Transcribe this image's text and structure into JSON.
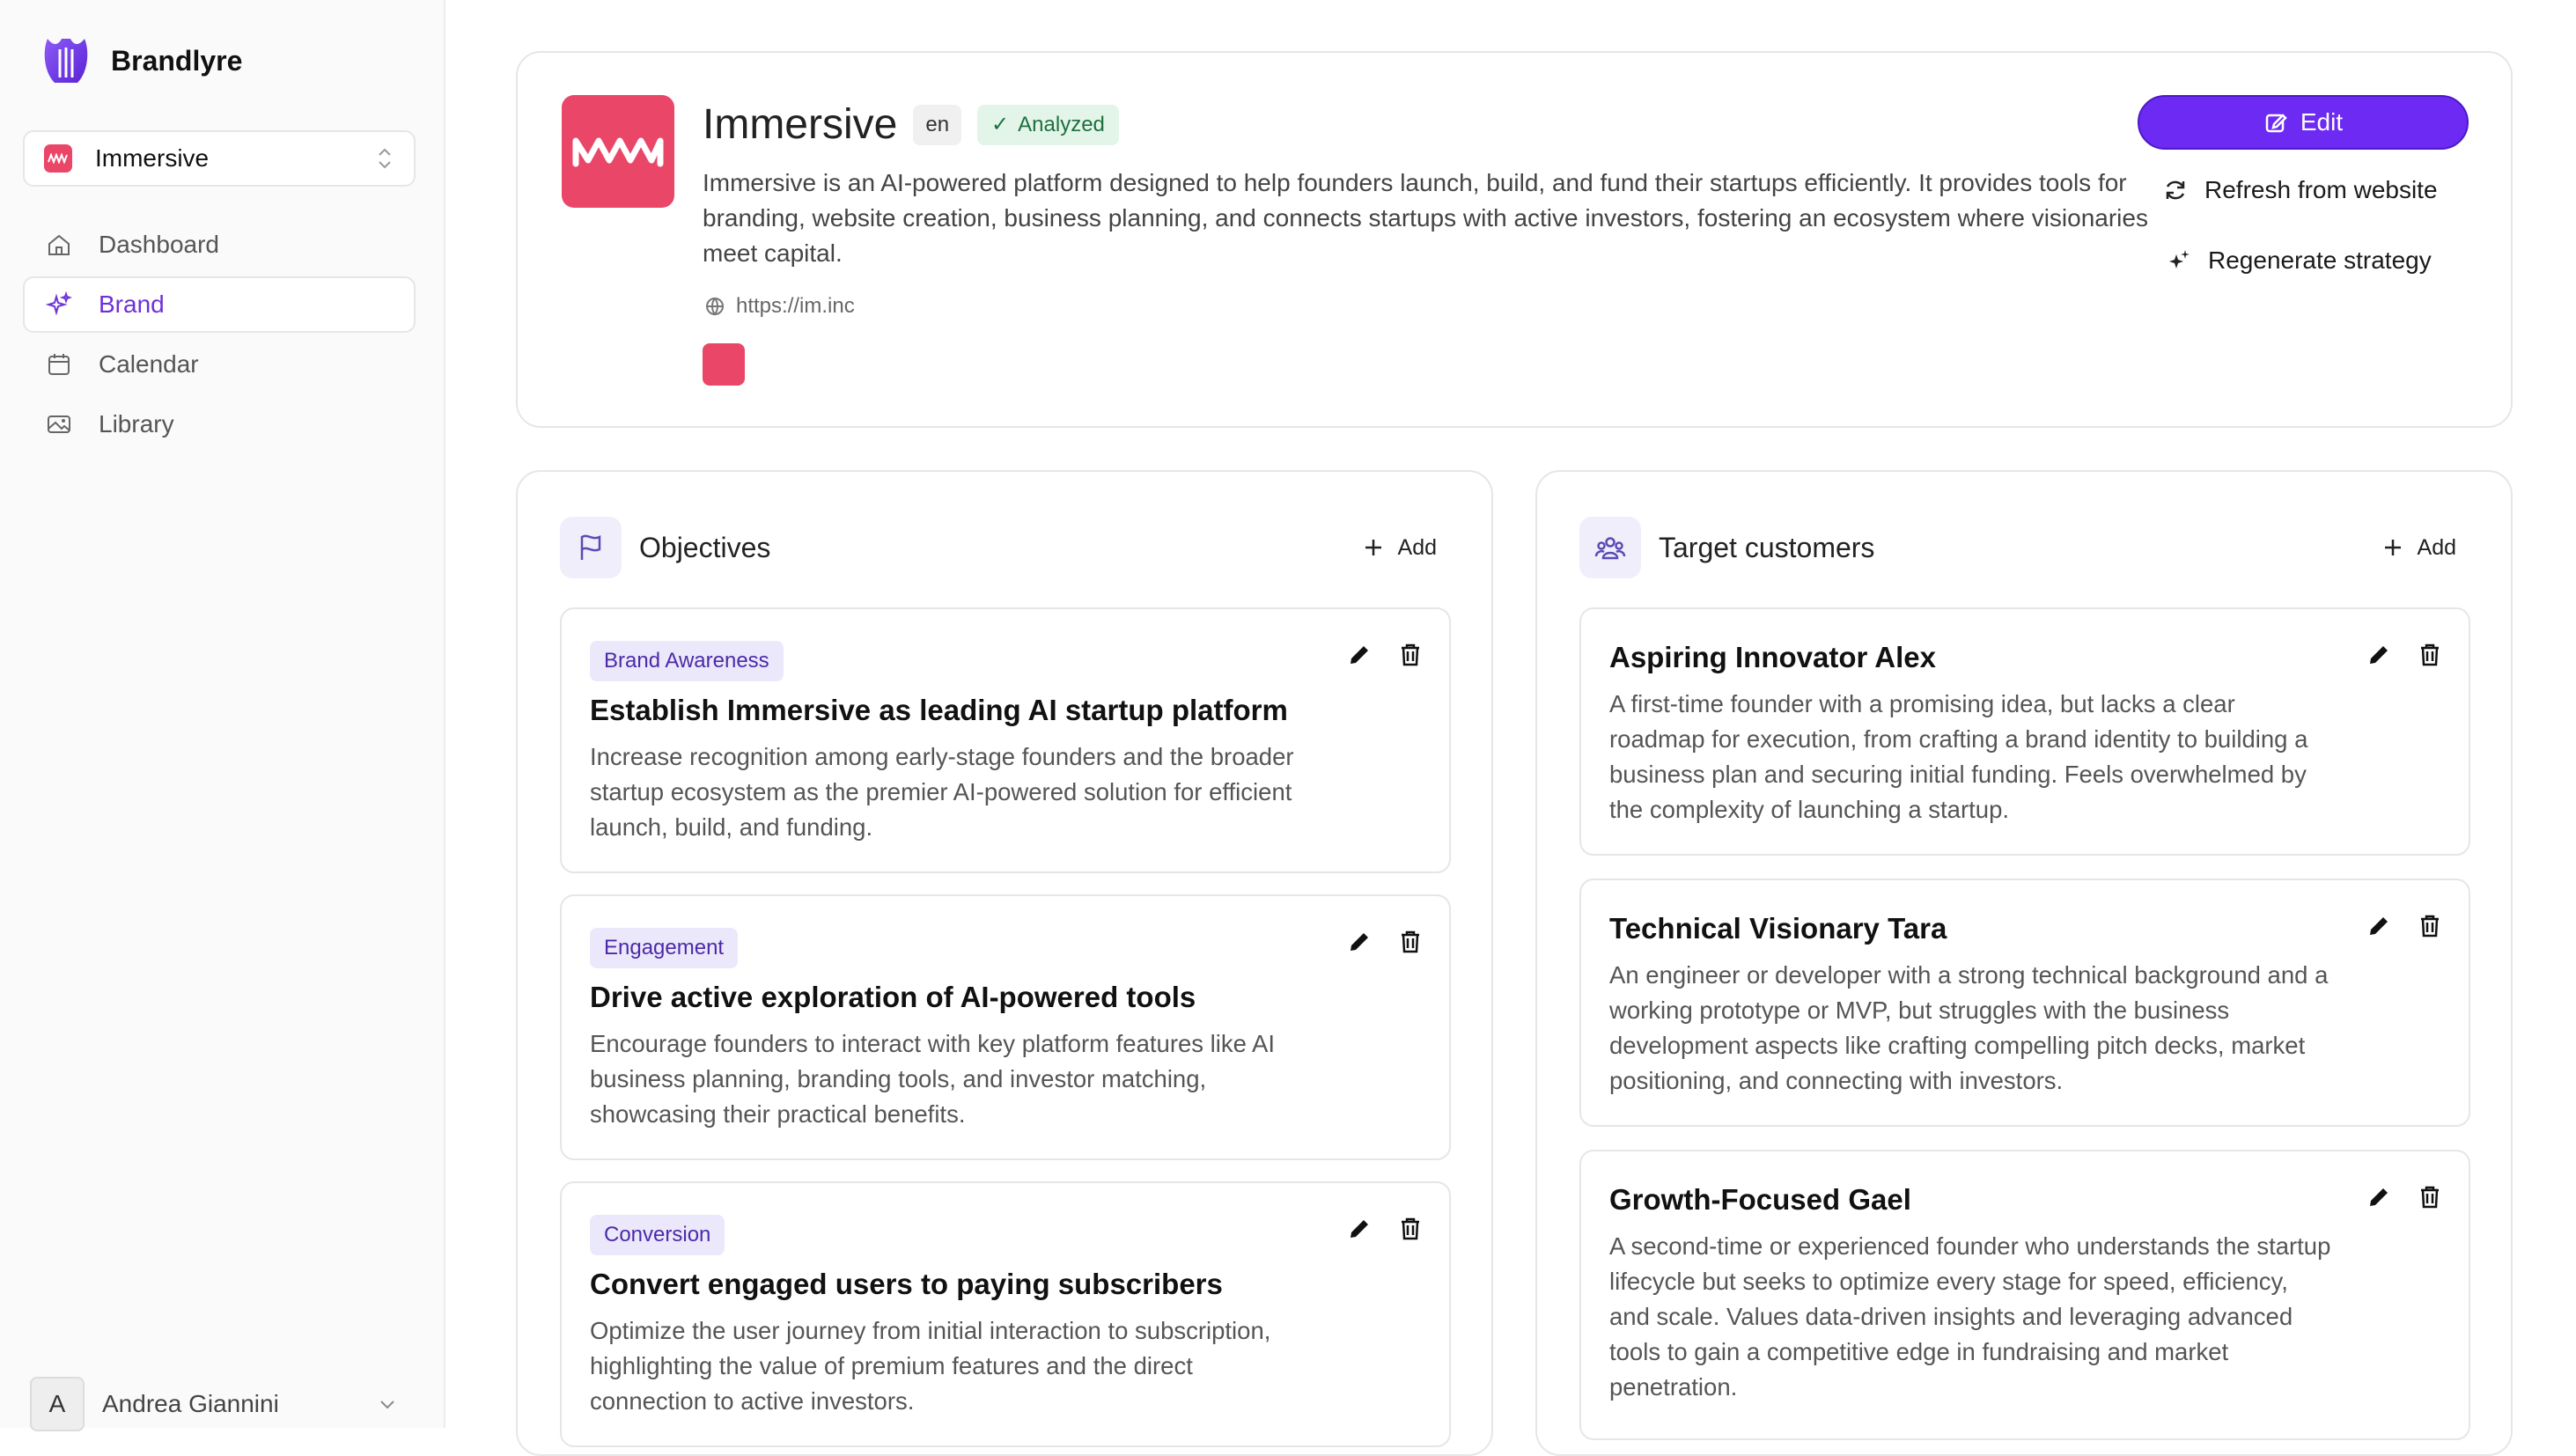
{
  "app": {
    "name": "Brandlyre"
  },
  "workspace": {
    "name": "Immersive"
  },
  "nav": [
    {
      "label": "Dashboard",
      "icon": "home-icon"
    },
    {
      "label": "Brand",
      "icon": "sparkles-icon",
      "active": true
    },
    {
      "label": "Calendar",
      "icon": "calendar-icon"
    },
    {
      "label": "Library",
      "icon": "image-icon"
    }
  ],
  "user": {
    "initial": "A",
    "name": "Andrea Giannini"
  },
  "brand": {
    "name": "Immersive",
    "lang": "en",
    "status": "Analyzed",
    "description": "Immersive is an AI-powered platform designed to help founders launch, build, and fund their startups efficiently. It provides tools for branding, website creation, business planning, and connects startups with active investors, fostering an ecosystem where visionaries meet capital.",
    "url": "https://im.inc",
    "color": "#ea4668",
    "actions": {
      "edit": "Edit",
      "refresh": "Refresh from website",
      "regenerate": "Regenerate strategy"
    }
  },
  "objectives": {
    "title": "Objectives",
    "add_label": "Add",
    "items": [
      {
        "tag": "Brand Awareness",
        "title": "Establish Immersive as leading AI startup platform",
        "description": "Increase recognition among early-stage founders and the broader startup ecosystem as the premier AI-powered solution for efficient launch, build, and funding."
      },
      {
        "tag": "Engagement",
        "title": "Drive active exploration of AI-powered tools",
        "description": "Encourage founders to interact with key platform features like AI business planning, branding tools, and investor matching, showcasing their practical benefits."
      },
      {
        "tag": "Conversion",
        "title": "Convert engaged users to paying subscribers",
        "description": "Optimize the user journey from initial interaction to subscription, highlighting the value of premium features and the direct connection to active investors."
      }
    ]
  },
  "targets": {
    "title": "Target customers",
    "add_label": "Add",
    "items": [
      {
        "title": "Aspiring Innovator Alex",
        "description": "A first-time founder with a promising idea, but lacks a clear roadmap for execution, from crafting a brand identity to building a business plan and securing initial funding. Feels overwhelmed by the complexity of launching a startup."
      },
      {
        "title": "Technical Visionary Tara",
        "description": "An engineer or developer with a strong technical background and a working prototype or MVP, but struggles with the business development aspects like crafting compelling pitch decks, market positioning, and connecting with investors."
      },
      {
        "title": "Growth-Focused Gael",
        "description": "A second-time or experienced founder who understands the startup lifecycle but seeks to optimize every stage for speed, efficiency, and scale. Values data-driven insights and leveraging advanced tools to gain a competitive edge in fundraising and market penetration."
      }
    ]
  }
}
